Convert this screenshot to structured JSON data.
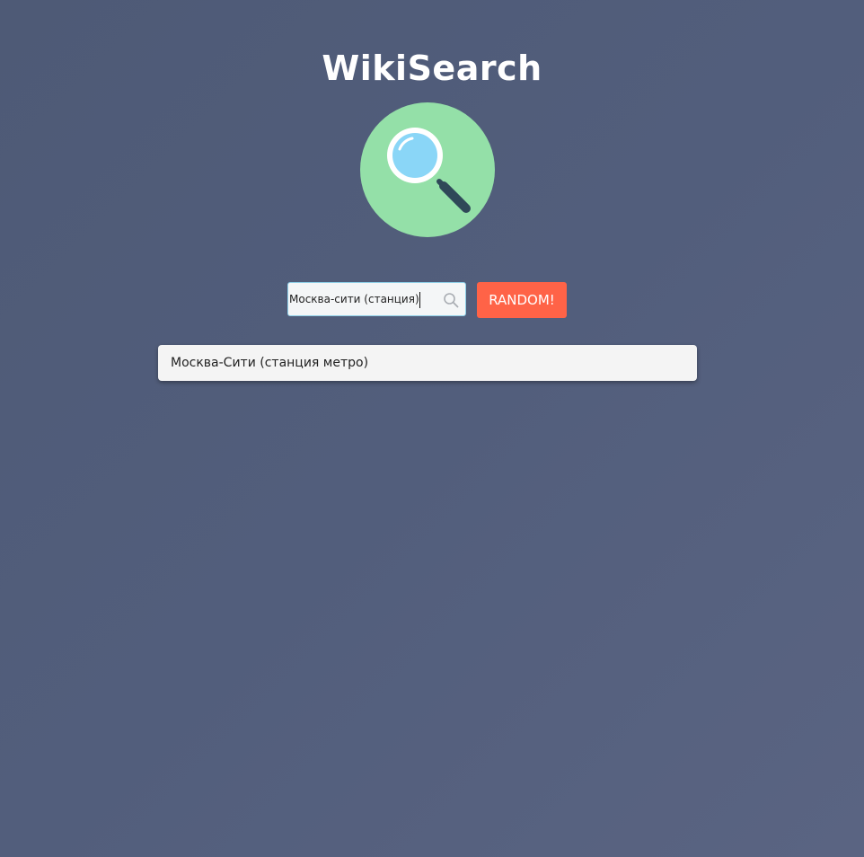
{
  "app": {
    "title": "WikiSearch"
  },
  "logo": {
    "icon": "magnifying-glass-icon",
    "colors": {
      "circle": "#94e0a8",
      "lens_ring": "#ffffff",
      "lens": "#8ad6f7",
      "handle": "#2f4858"
    }
  },
  "search": {
    "value": "Москва-сити (станция)",
    "placeholder": "",
    "icon": "search-icon"
  },
  "random_button": {
    "label": "RANDOM!",
    "color": "#ff6347"
  },
  "suggestions": [
    {
      "label": "Москва-Сити (станция метро)"
    }
  ],
  "colors": {
    "background": "#525e7c",
    "title_text": "#ffffff",
    "suggestion_bg": "#f4f4f4"
  }
}
